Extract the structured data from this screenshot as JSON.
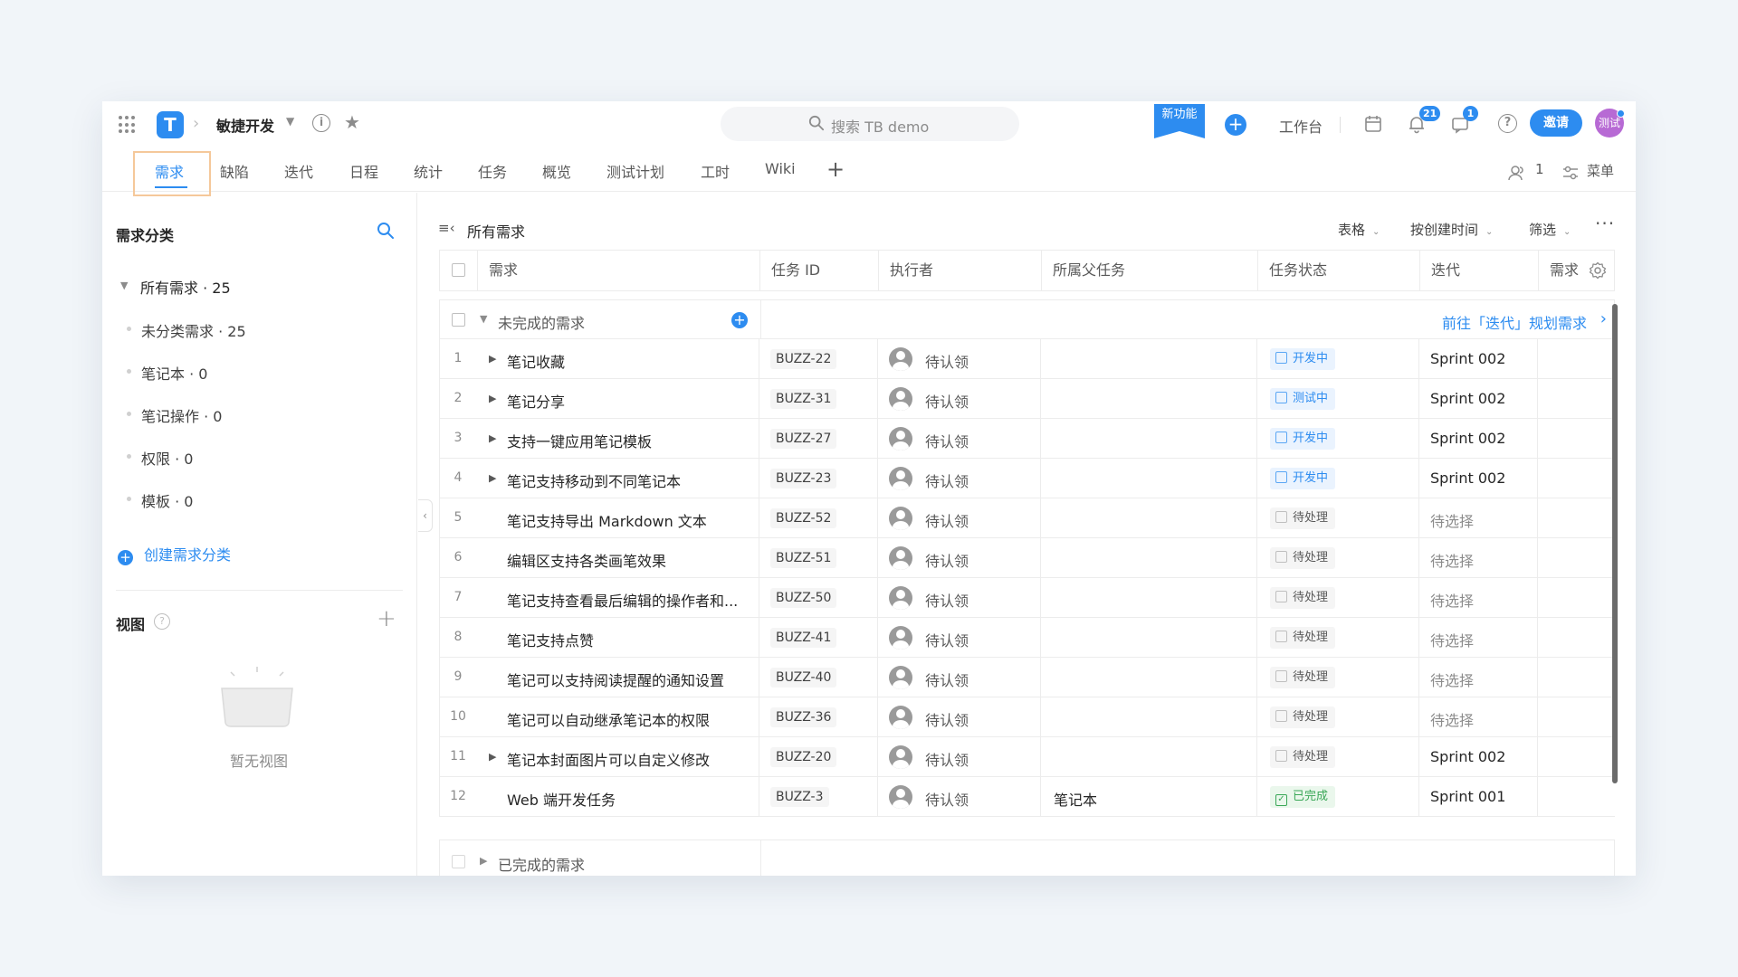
{
  "topbar": {
    "project_name": "敏捷开发",
    "search_placeholder": "搜索 TB demo",
    "new_feature": "新功能",
    "workbench": "工作台",
    "notification_count": "21",
    "message_count": "1",
    "invite": "邀请",
    "avatar_text": "测试"
  },
  "tabs": [
    {
      "label": "需求"
    },
    {
      "label": "缺陷"
    },
    {
      "label": "迭代"
    },
    {
      "label": "日程"
    },
    {
      "label": "统计"
    },
    {
      "label": "任务"
    },
    {
      "label": "概览"
    },
    {
      "label": "测试计划"
    },
    {
      "label": "工时"
    },
    {
      "label": "Wiki"
    }
  ],
  "tabs_right": {
    "members": "1",
    "menu": "菜单"
  },
  "sidebar": {
    "title": "需求分类",
    "all": "所有需求 · 25",
    "items": [
      {
        "label": "未分类需求 · 25"
      },
      {
        "label": "笔记本 · 0"
      },
      {
        "label": "笔记操作 · 0"
      },
      {
        "label": "权限 · 0"
      },
      {
        "label": "模板 · 0"
      }
    ],
    "create": "创建需求分类",
    "view_title": "视图",
    "empty_text": "暂无视图"
  },
  "main": {
    "title": "所有需求",
    "view_mode": "表格",
    "sort": "按创建时间",
    "filter": "筛选"
  },
  "table": {
    "columns": {
      "title": "需求",
      "task_id": "任务 ID",
      "assignee": "执行者",
      "parent": "所属父任务",
      "status": "任务状态",
      "iteration": "迭代",
      "extra": "需求"
    },
    "group_open": "未完成的需求",
    "group_link": "前往「迭代」规划需求",
    "group_done": "已完成的需求",
    "rows": [
      {
        "num": "1",
        "title": "笔记收藏",
        "id": "BUZZ-22",
        "assignee": "待认领",
        "parent": "",
        "status": "开发中",
        "iteration": "Sprint 002"
      },
      {
        "num": "2",
        "title": "笔记分享",
        "id": "BUZZ-31",
        "assignee": "待认领",
        "parent": "",
        "status": "测试中",
        "iteration": "Sprint 002"
      },
      {
        "num": "3",
        "title": "支持一键应用笔记模板",
        "id": "BUZZ-27",
        "assignee": "待认领",
        "parent": "",
        "status": "开发中",
        "iteration": "Sprint 002"
      },
      {
        "num": "4",
        "title": "笔记支持移动到不同笔记本",
        "id": "BUZZ-23",
        "assignee": "待认领",
        "parent": "",
        "status": "开发中",
        "iteration": "Sprint 002"
      },
      {
        "num": "5",
        "title": "笔记支持导出 Markdown 文本",
        "id": "BUZZ-52",
        "assignee": "待认领",
        "parent": "",
        "status": "待处理",
        "iteration": "待选择"
      },
      {
        "num": "6",
        "title": "编辑区支持各类画笔效果",
        "id": "BUZZ-51",
        "assignee": "待认领",
        "parent": "",
        "status": "待处理",
        "iteration": "待选择"
      },
      {
        "num": "7",
        "title": "笔记支持查看最后编辑的操作者和...",
        "id": "BUZZ-50",
        "assignee": "待认领",
        "parent": "",
        "status": "待处理",
        "iteration": "待选择"
      },
      {
        "num": "8",
        "title": "笔记支持点赞",
        "id": "BUZZ-41",
        "assignee": "待认领",
        "parent": "",
        "status": "待处理",
        "iteration": "待选择"
      },
      {
        "num": "9",
        "title": "笔记可以支持阅读提醒的通知设置",
        "id": "BUZZ-40",
        "assignee": "待认领",
        "parent": "",
        "status": "待处理",
        "iteration": "待选择"
      },
      {
        "num": "10",
        "title": "笔记可以自动继承笔记本的权限",
        "id": "BUZZ-36",
        "assignee": "待认领",
        "parent": "",
        "status": "待处理",
        "iteration": "待选择"
      },
      {
        "num": "11",
        "title": "笔记本封面图片可以自定义修改",
        "id": "BUZZ-20",
        "assignee": "待认领",
        "parent": "",
        "status": "待处理",
        "iteration": "Sprint 002"
      },
      {
        "num": "12",
        "title": "Web 端开发任务",
        "id": "BUZZ-3",
        "assignee": "待认领",
        "parent": "笔记本",
        "status": "已完成",
        "iteration": "Sprint 001"
      }
    ]
  }
}
